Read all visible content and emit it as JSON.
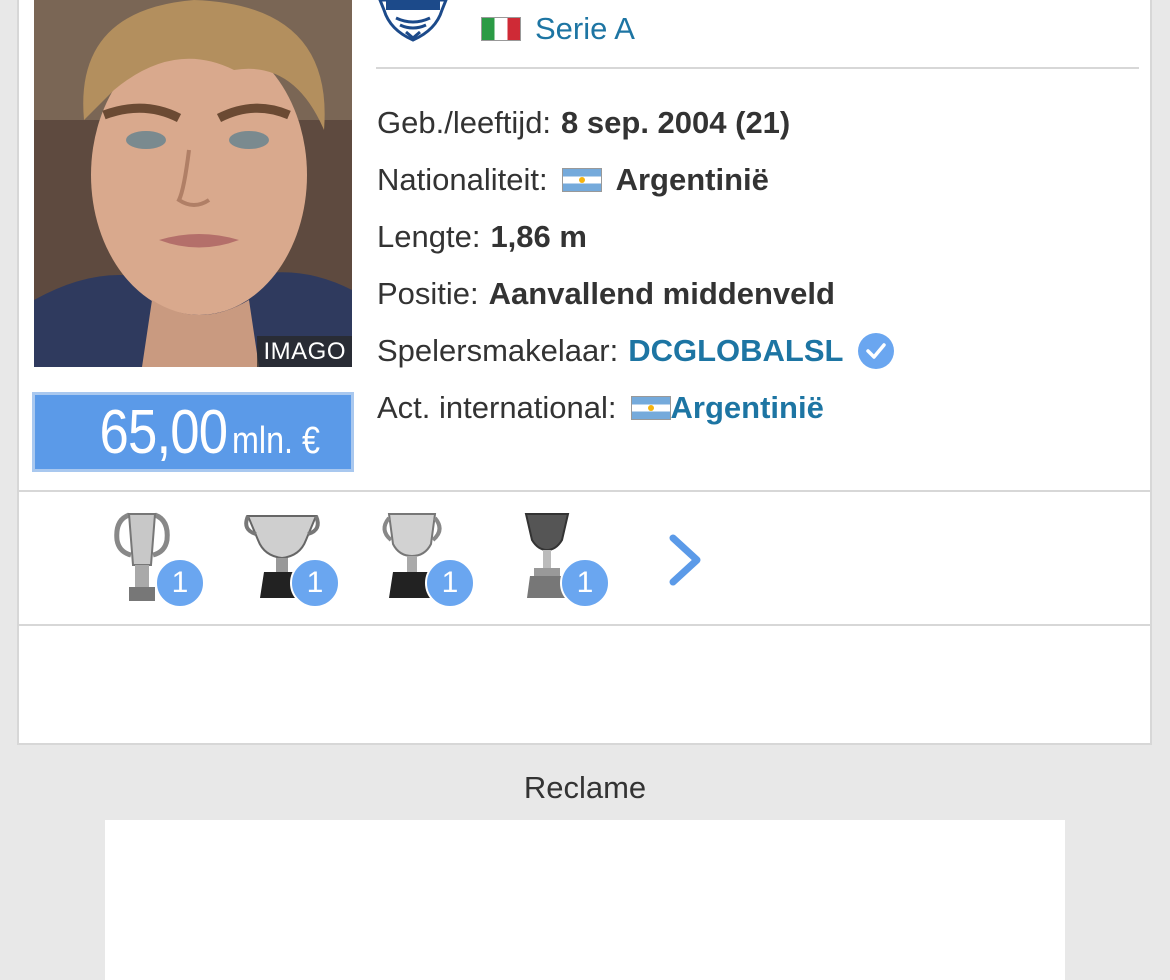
{
  "player": {
    "photo_credit": "IMAGO",
    "market_value": {
      "amount": "65,00",
      "unit": "mln. €"
    }
  },
  "club": {
    "logo_icon": "como-club-crest-icon",
    "league": {
      "flag": "italy-flag-icon",
      "name": "Serie A"
    }
  },
  "info": [
    {
      "label": "Geb./leeftijd:",
      "value": "8 sep. 2004 (21)"
    },
    {
      "label": "Nationaliteit:",
      "flag": "argentina-flag-icon",
      "value": "Argentinië"
    },
    {
      "label": "Lengte:",
      "value": "1,86 m"
    },
    {
      "label": "Positie:",
      "value": "Aanvallend middenveld"
    },
    {
      "label": "Spelersmakelaar:",
      "value": "DCGLOBALSL",
      "icon": "verified-check-icon"
    },
    {
      "label": "Act. international:",
      "flag": "argentina-flag-icon",
      "value": "Argentinië"
    }
  ],
  "trophies": [
    {
      "icon": "champions-league-trophy-icon",
      "count": "1"
    },
    {
      "icon": "la-liga-trophy-icon",
      "count": "1"
    },
    {
      "icon": "copa-del-rey-trophy-icon",
      "count": "1"
    },
    {
      "icon": "supercopa-trophy-icon",
      "count": "1"
    }
  ],
  "trophies_next_icon": "chevron-right-icon",
  "ad": {
    "label": "Reclame"
  },
  "colors": {
    "link": "#1d75a3",
    "value_bg": "#5b9ae8",
    "badge": "#6aa6f0",
    "page_bg": "#e8e8e8"
  }
}
